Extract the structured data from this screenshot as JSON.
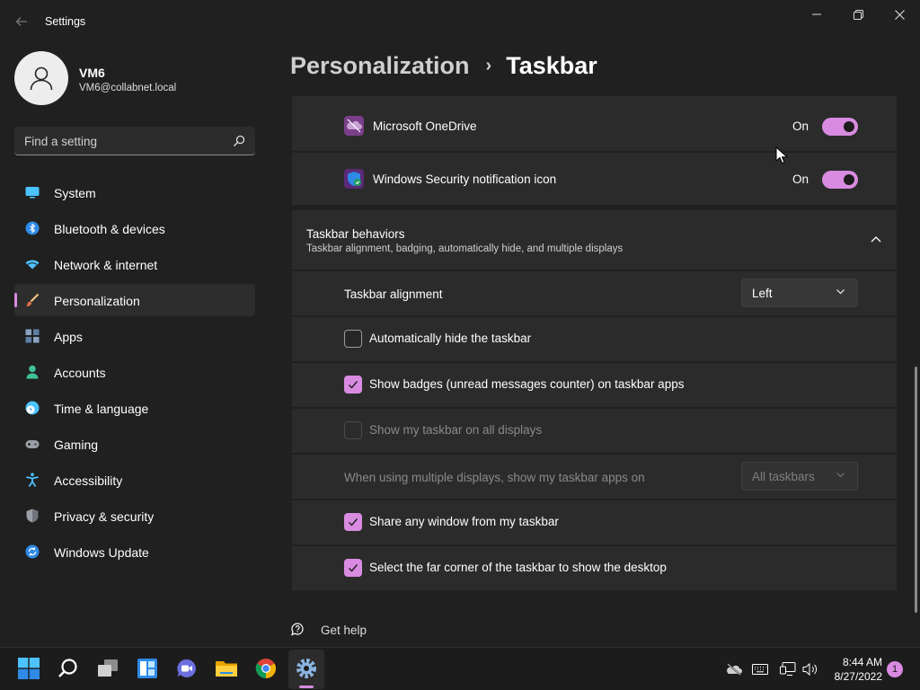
{
  "window": {
    "title": "Settings"
  },
  "user": {
    "name": "VM6",
    "email": "VM6@collabnet.local"
  },
  "search": {
    "placeholder": "Find a setting"
  },
  "sidebar": {
    "items": [
      {
        "label": "System",
        "icon": "system-icon"
      },
      {
        "label": "Bluetooth & devices",
        "icon": "bluetooth-icon"
      },
      {
        "label": "Network & internet",
        "icon": "wifi-icon"
      },
      {
        "label": "Personalization",
        "icon": "brush-icon",
        "active": true
      },
      {
        "label": "Apps",
        "icon": "apps-icon"
      },
      {
        "label": "Accounts",
        "icon": "person-icon"
      },
      {
        "label": "Time & language",
        "icon": "clock-globe-icon"
      },
      {
        "label": "Gaming",
        "icon": "gamepad-icon"
      },
      {
        "label": "Accessibility",
        "icon": "accessibility-icon"
      },
      {
        "label": "Privacy & security",
        "icon": "shield-icon"
      },
      {
        "label": "Windows Update",
        "icon": "update-icon"
      }
    ]
  },
  "breadcrumb": {
    "parent": "Personalization",
    "separator": "›",
    "current": "Taskbar"
  },
  "corner_icons": {
    "onedrive": {
      "label": "Microsoft OneDrive",
      "state": "On"
    },
    "security": {
      "label": "Windows Security notification icon",
      "state": "On"
    }
  },
  "behaviors": {
    "title": "Taskbar behaviors",
    "subtitle": "Taskbar alignment, badging, automatically hide, and multiple displays",
    "alignment": {
      "label": "Taskbar alignment",
      "value": "Left"
    },
    "autohide": {
      "label": "Automatically hide the taskbar",
      "checked": false
    },
    "badges": {
      "label": "Show badges (unread messages counter) on taskbar apps",
      "checked": true
    },
    "all_displays": {
      "label": "Show my taskbar on all displays",
      "checked": false,
      "disabled": true
    },
    "multi_display": {
      "label": "When using multiple displays, show my taskbar apps on",
      "value": "All taskbars",
      "disabled": true
    },
    "share_window": {
      "label": "Share any window from my taskbar",
      "checked": true
    },
    "far_corner": {
      "label": "Select the far corner of the taskbar to show the desktop",
      "checked": true
    }
  },
  "help": {
    "label": "Get help"
  },
  "taskbar": {
    "apps": [
      "start-icon",
      "search-icon",
      "task-view-icon",
      "widgets-icon",
      "chat-icon",
      "file-explorer-icon",
      "chrome-icon",
      "settings-icon"
    ],
    "tray": [
      "onedrive-icon",
      "keyboard-icon",
      "network-icon",
      "volume-icon"
    ],
    "time": "8:44 AM",
    "date": "8/27/2022",
    "notification_count": "1"
  },
  "colors": {
    "accent": "#d88be0",
    "background": "#202020",
    "card": "#2b2b2b"
  }
}
